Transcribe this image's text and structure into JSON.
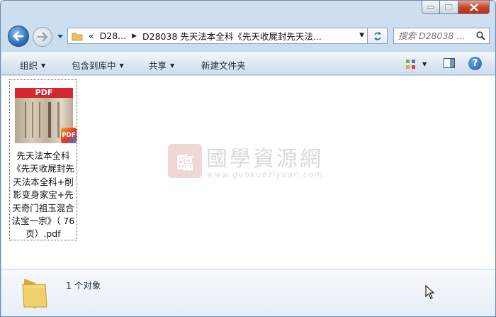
{
  "window": {
    "caption_buttons": [
      "minimize-icon",
      "maximize-icon",
      "close-icon"
    ]
  },
  "address": {
    "overflow": "«",
    "segments": [
      "D28...",
      "D28038 先天法本全科《先天收屍封先天法..."
    ]
  },
  "search": {
    "placeholder": "搜索 D28038 ..."
  },
  "commands": {
    "organize": "组织",
    "include_in_library": "包含到库中",
    "share": "共享",
    "new_folder": "新建文件夹"
  },
  "file": {
    "thumb_label": "PDF",
    "badge": "PDF",
    "name": "先天法本全科《先天收屍封先天法本全科+削影变身家宝+先天奇门祖玉混合法宝一宗》（ 76 页）.pdf"
  },
  "watermark": {
    "seal": "臨",
    "title": "國學資源網",
    "url": "www.guoxueziyuan.com"
  },
  "details": {
    "count": "1 个对象"
  },
  "colors": {
    "pdf_red": "#d4272f",
    "window_blue": "#c3d8ec"
  }
}
